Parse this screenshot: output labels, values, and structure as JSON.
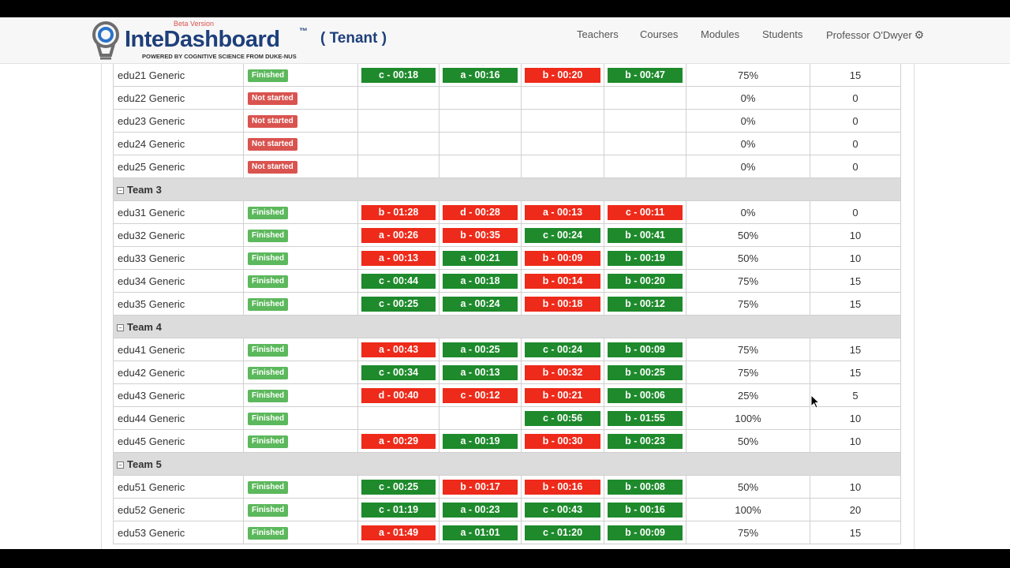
{
  "header": {
    "beta": "Beta Version",
    "logo_title": "InteDashboard",
    "logo_tm": "™",
    "logo_tagline": "POWERED BY COGNITIVE SCIENCE FROM DUKE-NUS",
    "tenant": "( Tenant )",
    "nav": {
      "teachers": "Teachers",
      "courses": "Courses",
      "modules": "Modules",
      "students": "Students",
      "user": "Professor O'Dwyer"
    }
  },
  "colors": {
    "correct": "#1e8a2c",
    "wrong": "#ee2a1a",
    "finished": "#5cb85c",
    "not_started": "#d9534f",
    "brand": "#1e3f7a"
  },
  "rows": [
    {
      "type": "student",
      "name": "edu21 Generic",
      "status": "Finished",
      "answers": [
        {
          "t": "c - 00:18",
          "c": "green"
        },
        {
          "t": "a - 00:16",
          "c": "green"
        },
        {
          "t": "b - 00:20",
          "c": "red"
        },
        {
          "t": "b - 00:47",
          "c": "green"
        }
      ],
      "percent": "75%",
      "score": "15"
    },
    {
      "type": "student",
      "name": "edu22 Generic",
      "status": "Not started",
      "answers": [],
      "percent": "0%",
      "score": "0"
    },
    {
      "type": "student",
      "name": "edu23 Generic",
      "status": "Not started",
      "answers": [],
      "percent": "0%",
      "score": "0"
    },
    {
      "type": "student",
      "name": "edu24 Generic",
      "status": "Not started",
      "answers": [],
      "percent": "0%",
      "score": "0"
    },
    {
      "type": "student",
      "name": "edu25 Generic",
      "status": "Not started",
      "answers": [],
      "percent": "0%",
      "score": "0"
    },
    {
      "type": "team",
      "label": "Team 3"
    },
    {
      "type": "student",
      "name": "edu31 Generic",
      "status": "Finished",
      "answers": [
        {
          "t": "b - 01:28",
          "c": "red"
        },
        {
          "t": "d - 00:28",
          "c": "red"
        },
        {
          "t": "a - 00:13",
          "c": "red"
        },
        {
          "t": "c - 00:11",
          "c": "red"
        }
      ],
      "percent": "0%",
      "score": "0"
    },
    {
      "type": "student",
      "name": "edu32 Generic",
      "status": "Finished",
      "answers": [
        {
          "t": "a - 00:26",
          "c": "red"
        },
        {
          "t": "b - 00:35",
          "c": "red"
        },
        {
          "t": "c - 00:24",
          "c": "green"
        },
        {
          "t": "b - 00:41",
          "c": "green"
        }
      ],
      "percent": "50%",
      "score": "10"
    },
    {
      "type": "student",
      "name": "edu33 Generic",
      "status": "Finished",
      "answers": [
        {
          "t": "a - 00:13",
          "c": "red"
        },
        {
          "t": "a - 00:21",
          "c": "green"
        },
        {
          "t": "b - 00:09",
          "c": "red"
        },
        {
          "t": "b - 00:19",
          "c": "green"
        }
      ],
      "percent": "50%",
      "score": "10"
    },
    {
      "type": "student",
      "name": "edu34 Generic",
      "status": "Finished",
      "answers": [
        {
          "t": "c - 00:44",
          "c": "green"
        },
        {
          "t": "a - 00:18",
          "c": "green"
        },
        {
          "t": "b - 00:14",
          "c": "red"
        },
        {
          "t": "b - 00:20",
          "c": "green"
        }
      ],
      "percent": "75%",
      "score": "15"
    },
    {
      "type": "student",
      "name": "edu35 Generic",
      "status": "Finished",
      "answers": [
        {
          "t": "c - 00:25",
          "c": "green"
        },
        {
          "t": "a - 00:24",
          "c": "green"
        },
        {
          "t": "b - 00:18",
          "c": "red"
        },
        {
          "t": "b - 00:12",
          "c": "green"
        }
      ],
      "percent": "75%",
      "score": "15"
    },
    {
      "type": "team",
      "label": "Team 4"
    },
    {
      "type": "student",
      "name": "edu41 Generic",
      "status": "Finished",
      "answers": [
        {
          "t": "a - 00:43",
          "c": "red"
        },
        {
          "t": "a - 00:25",
          "c": "green"
        },
        {
          "t": "c - 00:24",
          "c": "green"
        },
        {
          "t": "b - 00:09",
          "c": "green"
        }
      ],
      "percent": "75%",
      "score": "15"
    },
    {
      "type": "student",
      "name": "edu42 Generic",
      "status": "Finished",
      "answers": [
        {
          "t": "c - 00:34",
          "c": "green"
        },
        {
          "t": "a - 00:13",
          "c": "green"
        },
        {
          "t": "b - 00:32",
          "c": "red"
        },
        {
          "t": "b - 00:25",
          "c": "green"
        }
      ],
      "percent": "75%",
      "score": "15"
    },
    {
      "type": "student",
      "name": "edu43 Generic",
      "status": "Finished",
      "answers": [
        {
          "t": "d - 00:40",
          "c": "red"
        },
        {
          "t": "c - 00:12",
          "c": "red"
        },
        {
          "t": "b - 00:21",
          "c": "red"
        },
        {
          "t": "b - 00:06",
          "c": "green"
        }
      ],
      "percent": "25%",
      "score": "5"
    },
    {
      "type": "student",
      "name": "edu44 Generic",
      "status": "Finished",
      "answers": [
        null,
        null,
        {
          "t": "c - 00:56",
          "c": "green"
        },
        {
          "t": "b - 01:55",
          "c": "green"
        }
      ],
      "percent": "100%",
      "score": "10"
    },
    {
      "type": "student",
      "name": "edu45 Generic",
      "status": "Finished",
      "answers": [
        {
          "t": "a - 00:29",
          "c": "red"
        },
        {
          "t": "a - 00:19",
          "c": "green"
        },
        {
          "t": "b - 00:30",
          "c": "red"
        },
        {
          "t": "b - 00:23",
          "c": "green"
        }
      ],
      "percent": "50%",
      "score": "10"
    },
    {
      "type": "team",
      "label": "Team 5"
    },
    {
      "type": "student",
      "name": "edu51 Generic",
      "status": "Finished",
      "answers": [
        {
          "t": "c - 00:25",
          "c": "green"
        },
        {
          "t": "b - 00:17",
          "c": "red"
        },
        {
          "t": "b - 00:16",
          "c": "red"
        },
        {
          "t": "b - 00:08",
          "c": "green"
        }
      ],
      "percent": "50%",
      "score": "10"
    },
    {
      "type": "student",
      "name": "edu52 Generic",
      "status": "Finished",
      "answers": [
        {
          "t": "c - 01:19",
          "c": "green"
        },
        {
          "t": "a - 00:23",
          "c": "green"
        },
        {
          "t": "c - 00:43",
          "c": "green"
        },
        {
          "t": "b - 00:16",
          "c": "green"
        }
      ],
      "percent": "100%",
      "score": "20"
    },
    {
      "type": "student",
      "name": "edu53 Generic",
      "status": "Finished",
      "answers": [
        {
          "t": "a - 01:49",
          "c": "red"
        },
        {
          "t": "a - 01:01",
          "c": "green"
        },
        {
          "t": "c - 01:20",
          "c": "green"
        },
        {
          "t": "b - 00:09",
          "c": "green"
        }
      ],
      "percent": "75%",
      "score": "15"
    }
  ]
}
